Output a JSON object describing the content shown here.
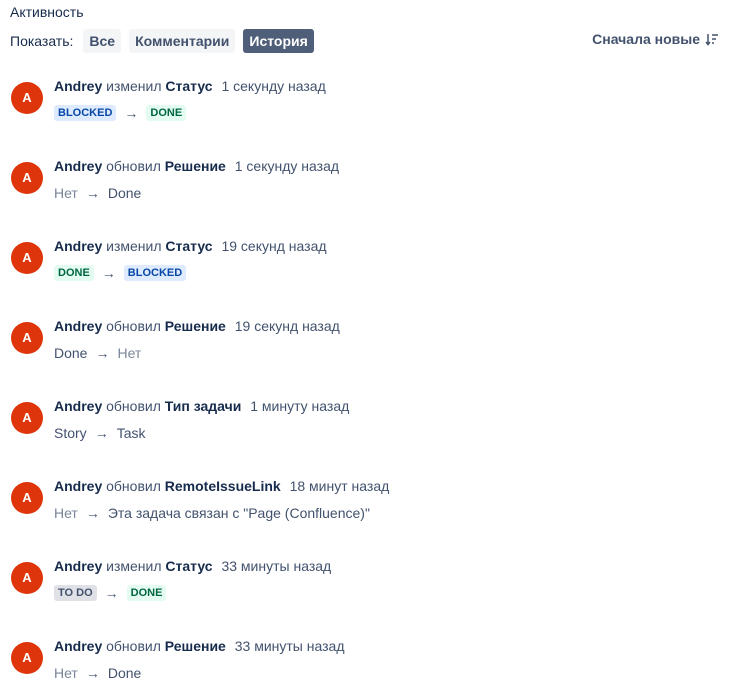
{
  "header": {
    "title": "Активность",
    "show_label": "Показать:",
    "filters": [
      "Все",
      "Комментарии",
      "История"
    ],
    "active_filter": "История",
    "sort_label": "Сначала новые"
  },
  "colors": {
    "avatar": "#de350b",
    "active_chip": "#505f79",
    "lozenge_blue": "#deebff",
    "lozenge_green": "#e3fcef",
    "lozenge_grey": "#dfe1e6"
  },
  "entries": [
    {
      "avatar": "A",
      "user": "Andrey",
      "action": "изменил",
      "field": "Статус",
      "time": "1 секунду назад",
      "from": "BLOCKED",
      "arrow": "→",
      "to": "DONE"
    },
    {
      "avatar": "A",
      "user": "Andrey",
      "action": "обновил",
      "field": "Решение",
      "time": "1 секунду назад",
      "from": "Нет",
      "arrow": "→",
      "to": "Done"
    },
    {
      "avatar": "A",
      "user": "Andrey",
      "action": "изменил",
      "field": "Статус",
      "time": "19 секунд назад",
      "from": "DONE",
      "arrow": "→",
      "to": "BLOCKED"
    },
    {
      "avatar": "A",
      "user": "Andrey",
      "action": "обновил",
      "field": "Решение",
      "time": "19 секунд назад",
      "from": "Done",
      "arrow": "→",
      "to": "Нет"
    },
    {
      "avatar": "A",
      "user": "Andrey",
      "action": "обновил",
      "field": "Тип задачи",
      "time": "1 минуту назад",
      "from": "Story",
      "arrow": "→",
      "to": "Task"
    },
    {
      "avatar": "A",
      "user": "Andrey",
      "action": "обновил",
      "field": "RemoteIssueLink",
      "time": "18 минут назад",
      "from": "Нет",
      "arrow": "→",
      "to": "Эта задача связан с \"Page (Confluence)\""
    },
    {
      "avatar": "A",
      "user": "Andrey",
      "action": "изменил",
      "field": "Статус",
      "time": "33 минуты назад",
      "from": "TO DO",
      "arrow": "→",
      "to": "DONE"
    },
    {
      "avatar": "A",
      "user": "Andrey",
      "action": "обновил",
      "field": "Решение",
      "time": "33 минуты назад",
      "from": "Нет",
      "arrow": "→",
      "to": "Done"
    }
  ]
}
